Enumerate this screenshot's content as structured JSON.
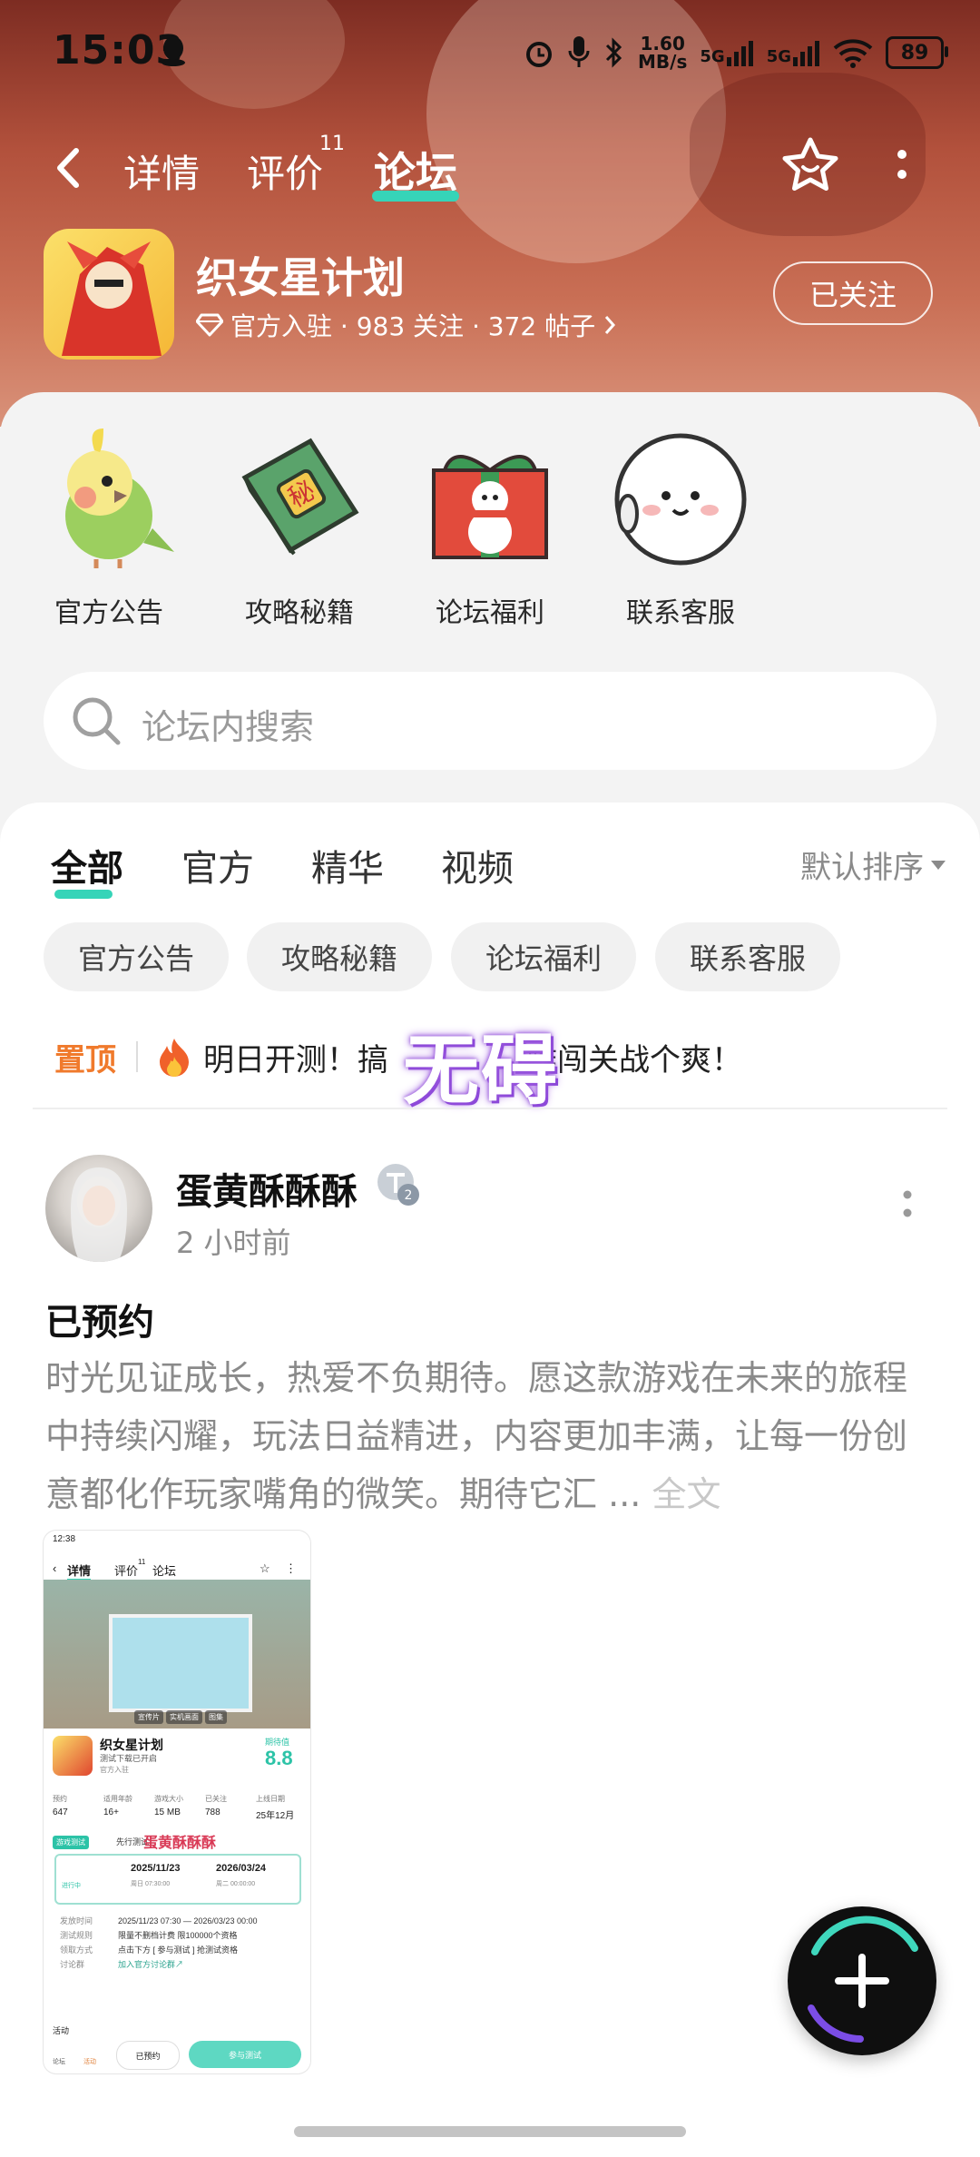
{
  "status_bar": {
    "time": "15:03",
    "net_speed_value": "1.60",
    "net_speed_unit": "MB/s",
    "signal1": "5G",
    "signal2": "5G",
    "battery": "89"
  },
  "nav": {
    "tabs": [
      {
        "label": "详情"
      },
      {
        "label": "评价",
        "badge": "11"
      },
      {
        "label": "论坛",
        "active": true
      }
    ]
  },
  "app": {
    "name": "织女星计划",
    "meta": "官方入驻 · 983 关注 · 372 帖子",
    "follow_label": "已关注"
  },
  "quick_links": [
    {
      "label": "官方公告",
      "icon": "parrot-icon"
    },
    {
      "label": "攻略秘籍",
      "icon": "secret-book-icon"
    },
    {
      "label": "论坛福利",
      "icon": "gift-box-icon"
    },
    {
      "label": "联系客服",
      "icon": "support-bun-icon"
    }
  ],
  "search": {
    "placeholder": "论坛内搜索"
  },
  "feed": {
    "tabs": [
      {
        "label": "全部",
        "active": true
      },
      {
        "label": "官方"
      },
      {
        "label": "精华"
      },
      {
        "label": "视频"
      }
    ],
    "sort_label": "默认排序",
    "chips": [
      "官方公告",
      "攻略秘籍",
      "论坛福利",
      "联系客服"
    ],
    "pinned": {
      "tag": "置顶",
      "text_before": "明日开测！搞",
      "text_after": "雕闯关战个爽！",
      "overlay": "无碍"
    }
  },
  "post": {
    "author": "蛋黄酥酥酥",
    "level": "2",
    "time": "2 小时前",
    "title": "已预约",
    "body": "时光见证成长，热爱不负期待。愿这款游戏在未来的旅程中持续闪耀，玩法日益精进，内容更加丰满，让每一份创意都化作玩家嘴角的微笑。期待它汇",
    "ellipsis": "...",
    "full_text_link": "全文",
    "image": {
      "status_time": "12:38",
      "nav_tabs": [
        "详情",
        "评价",
        "论坛"
      ],
      "nav_badge": "11",
      "banner_tabs": [
        "宣传片",
        "实机画面",
        "图集"
      ],
      "app_name": "织女星计划",
      "app_sub": "测试下载已开启",
      "app_official": "官方入驻",
      "rating_label": "期待值",
      "rating": "8.8",
      "stats": [
        {
          "label": "预约",
          "value": "647"
        },
        {
          "label": "适用年龄",
          "value": "16+"
        },
        {
          "label": "游戏大小",
          "value": "15 MB"
        },
        {
          "label": "已关注",
          "value": "788"
        },
        {
          "label": "上线日期",
          "value": "25年12月"
        }
      ],
      "test_tag": "游戏测试",
      "test_text": "先行测试",
      "watermark": "蛋黄酥酥酥",
      "start_date": "2025/11/23",
      "start_time": "周日 07:30:00",
      "end_date": "2026/03/24",
      "end_time": "周二 00:00:00",
      "state": "进行中",
      "rows": [
        {
          "k": "发放时间",
          "v": "2025/11/23 07:30 — 2026/03/23 00:00"
        },
        {
          "k": "测试规则",
          "v": "限量不删档计费 限100000个资格"
        },
        {
          "k": "领取方式",
          "v": "点击下方 [ 参与测试 ] 抢测试资格"
        },
        {
          "k": "讨论群",
          "v": "加入官方讨论群↗"
        }
      ],
      "activity": "活动",
      "btn_reserved": "已预约",
      "btn_join": "参与测试",
      "tab_forum": "论坛",
      "tab_activity": "活动"
    }
  },
  "colors": {
    "accent": "#36d4b8",
    "pinned": "#f07a2c",
    "header": "#b2513c"
  }
}
